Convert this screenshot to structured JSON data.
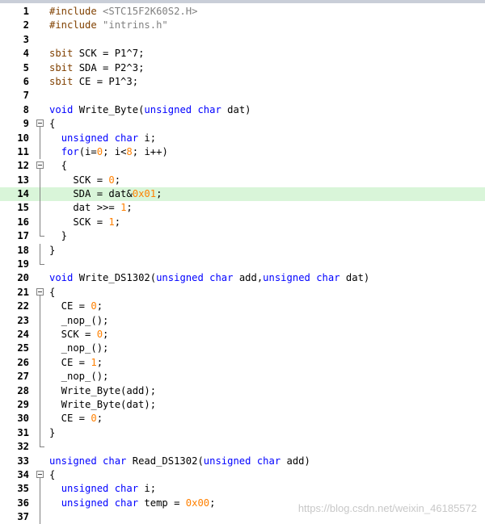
{
  "editor": {
    "lines": [
      {
        "n": "1",
        "segs": [
          {
            "t": "#include ",
            "c": "pp"
          },
          {
            "t": "<STC15F2K60S2.H>",
            "c": "str"
          }
        ]
      },
      {
        "n": "2",
        "segs": [
          {
            "t": "#include ",
            "c": "pp"
          },
          {
            "t": "\"intrins.h\"",
            "c": "str"
          }
        ]
      },
      {
        "n": "3",
        "segs": []
      },
      {
        "n": "4",
        "segs": [
          {
            "t": "sbit",
            "c": "pp"
          },
          {
            "t": " SCK = P1^7;"
          }
        ]
      },
      {
        "n": "5",
        "segs": [
          {
            "t": "sbit",
            "c": "pp"
          },
          {
            "t": " SDA = P2^3;"
          }
        ]
      },
      {
        "n": "6",
        "segs": [
          {
            "t": "sbit",
            "c": "pp"
          },
          {
            "t": " CE = P1^3;"
          }
        ]
      },
      {
        "n": "7",
        "segs": []
      },
      {
        "n": "8",
        "segs": [
          {
            "t": "void",
            "c": "kw"
          },
          {
            "t": " Write_Byte("
          },
          {
            "t": "unsigned char",
            "c": "kw"
          },
          {
            "t": " dat)"
          }
        ]
      },
      {
        "n": "9",
        "fold": "open",
        "segs": [
          {
            "t": "{"
          }
        ]
      },
      {
        "n": "10",
        "fold": "line",
        "segs": [
          {
            "t": "  "
          },
          {
            "t": "unsigned char",
            "c": "kw"
          },
          {
            "t": " i;"
          }
        ]
      },
      {
        "n": "11",
        "fold": "line",
        "segs": [
          {
            "t": "  "
          },
          {
            "t": "for",
            "c": "kw"
          },
          {
            "t": "(i="
          },
          {
            "t": "0",
            "c": "num"
          },
          {
            "t": "; i<"
          },
          {
            "t": "8",
            "c": "num"
          },
          {
            "t": "; i++)"
          }
        ]
      },
      {
        "n": "12",
        "fold": "open",
        "segs": [
          {
            "t": "  {"
          }
        ]
      },
      {
        "n": "13",
        "fold": "line",
        "segs": [
          {
            "t": "    SCK = "
          },
          {
            "t": "0",
            "c": "num"
          },
          {
            "t": ";"
          }
        ]
      },
      {
        "n": "14",
        "fold": "line",
        "hl": true,
        "segs": [
          {
            "t": "    SDA = dat&"
          },
          {
            "t": "0x01",
            "c": "num"
          },
          {
            "t": ";"
          }
        ]
      },
      {
        "n": "15",
        "fold": "line",
        "segs": [
          {
            "t": "    dat >>= "
          },
          {
            "t": "1",
            "c": "num"
          },
          {
            "t": ";"
          }
        ]
      },
      {
        "n": "16",
        "fold": "line",
        "segs": [
          {
            "t": "    SCK = "
          },
          {
            "t": "1",
            "c": "num"
          },
          {
            "t": ";"
          }
        ]
      },
      {
        "n": "17",
        "fold": "end",
        "segs": [
          {
            "t": "  }"
          }
        ]
      },
      {
        "n": "18",
        "fold": "line",
        "segs": [
          {
            "t": "}"
          }
        ]
      },
      {
        "n": "19",
        "fold": "end",
        "segs": []
      },
      {
        "n": "20",
        "segs": [
          {
            "t": "void",
            "c": "kw"
          },
          {
            "t": " Write_DS1302("
          },
          {
            "t": "unsigned char",
            "c": "kw"
          },
          {
            "t": " add,"
          },
          {
            "t": "unsigned char",
            "c": "kw"
          },
          {
            "t": " dat)"
          }
        ]
      },
      {
        "n": "21",
        "fold": "open",
        "segs": [
          {
            "t": "{"
          }
        ]
      },
      {
        "n": "22",
        "fold": "line",
        "segs": [
          {
            "t": "  CE = "
          },
          {
            "t": "0",
            "c": "num"
          },
          {
            "t": ";"
          }
        ]
      },
      {
        "n": "23",
        "fold": "line",
        "segs": [
          {
            "t": "  _nop_();"
          }
        ]
      },
      {
        "n": "24",
        "fold": "line",
        "segs": [
          {
            "t": "  SCK = "
          },
          {
            "t": "0",
            "c": "num"
          },
          {
            "t": ";"
          }
        ]
      },
      {
        "n": "25",
        "fold": "line",
        "segs": [
          {
            "t": "  _nop_();"
          }
        ]
      },
      {
        "n": "26",
        "fold": "line",
        "segs": [
          {
            "t": "  CE = "
          },
          {
            "t": "1",
            "c": "num"
          },
          {
            "t": ";"
          }
        ]
      },
      {
        "n": "27",
        "fold": "line",
        "segs": [
          {
            "t": "  _nop_();"
          }
        ]
      },
      {
        "n": "28",
        "fold": "line",
        "segs": [
          {
            "t": "  Write_Byte(add);"
          }
        ]
      },
      {
        "n": "29",
        "fold": "line",
        "segs": [
          {
            "t": "  Write_Byte(dat);"
          }
        ]
      },
      {
        "n": "30",
        "fold": "line",
        "segs": [
          {
            "t": "  CE = "
          },
          {
            "t": "0",
            "c": "num"
          },
          {
            "t": ";"
          }
        ]
      },
      {
        "n": "31",
        "fold": "line",
        "segs": [
          {
            "t": "}"
          }
        ]
      },
      {
        "n": "32",
        "fold": "end",
        "segs": []
      },
      {
        "n": "33",
        "segs": [
          {
            "t": "unsigned char",
            "c": "kw"
          },
          {
            "t": " Read_DS1302("
          },
          {
            "t": "unsigned char",
            "c": "kw"
          },
          {
            "t": " add)"
          }
        ]
      },
      {
        "n": "34",
        "fold": "open",
        "segs": [
          {
            "t": "{"
          }
        ]
      },
      {
        "n": "35",
        "fold": "line",
        "segs": [
          {
            "t": "  "
          },
          {
            "t": "unsigned char",
            "c": "kw"
          },
          {
            "t": " i;"
          }
        ]
      },
      {
        "n": "36",
        "fold": "line",
        "segs": [
          {
            "t": "  "
          },
          {
            "t": "unsigned char",
            "c": "kw"
          },
          {
            "t": " temp = "
          },
          {
            "t": "0x00",
            "c": "num"
          },
          {
            "t": ";"
          }
        ]
      },
      {
        "n": "37",
        "fold": "line",
        "segs": []
      }
    ]
  },
  "watermark": "https://blog.csdn.net/weixin_46185572"
}
